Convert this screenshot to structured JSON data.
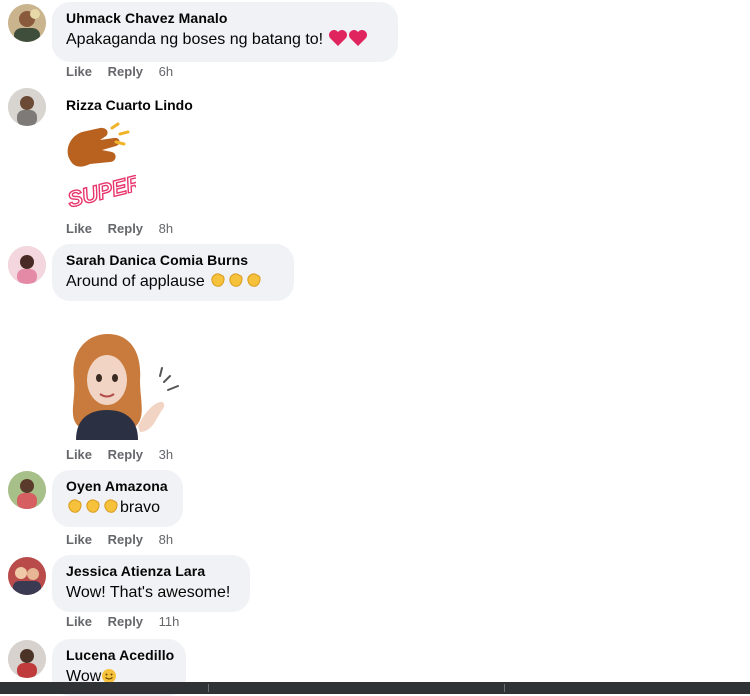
{
  "comments": [
    {
      "name": "Uhmack Chavez Manalo",
      "text": "Apakaganda ng boses ng batang to!",
      "emoji": [
        "red-heart",
        "red-heart"
      ],
      "actions": {
        "like": "Like",
        "reply": "Reply",
        "time": "6h"
      }
    },
    {
      "name": "Rizza Cuarto Lindo",
      "sticker": "super-clapping-sticker",
      "sticker_text": "SUPER!",
      "actions": {
        "like": "Like",
        "reply": "Reply",
        "time": "8h"
      }
    },
    {
      "name": "Sarah Danica Comia Burns",
      "text": "Around of applause",
      "emoji": [
        "clapping-hands",
        "clapping-hands",
        "clapping-hands"
      ],
      "sticker": "avatar-waving-sticker",
      "actions": {
        "like": "Like",
        "reply": "Reply",
        "time": "3h"
      }
    },
    {
      "name": "Oyen Amazona",
      "text": "bravo",
      "emoji": [
        "clapping-hands",
        "clapping-hands",
        "clapping-hands"
      ],
      "actions": {
        "like": "Like",
        "reply": "Reply",
        "time": "8h"
      }
    },
    {
      "name": "Jessica Atienza Lara",
      "text": "Wow! That's awesome!",
      "actions": {
        "like": "Like",
        "reply": "Reply",
        "time": "11h"
      }
    },
    {
      "name": "Lucena Acedillo",
      "text": "Wow",
      "emoji": [
        "smiling-face"
      ]
    }
  ],
  "colors": {
    "bubble": "#f0f2f5",
    "meta_text": "#65676b",
    "heart": "#e0245e",
    "clap": "#f7c23b"
  }
}
